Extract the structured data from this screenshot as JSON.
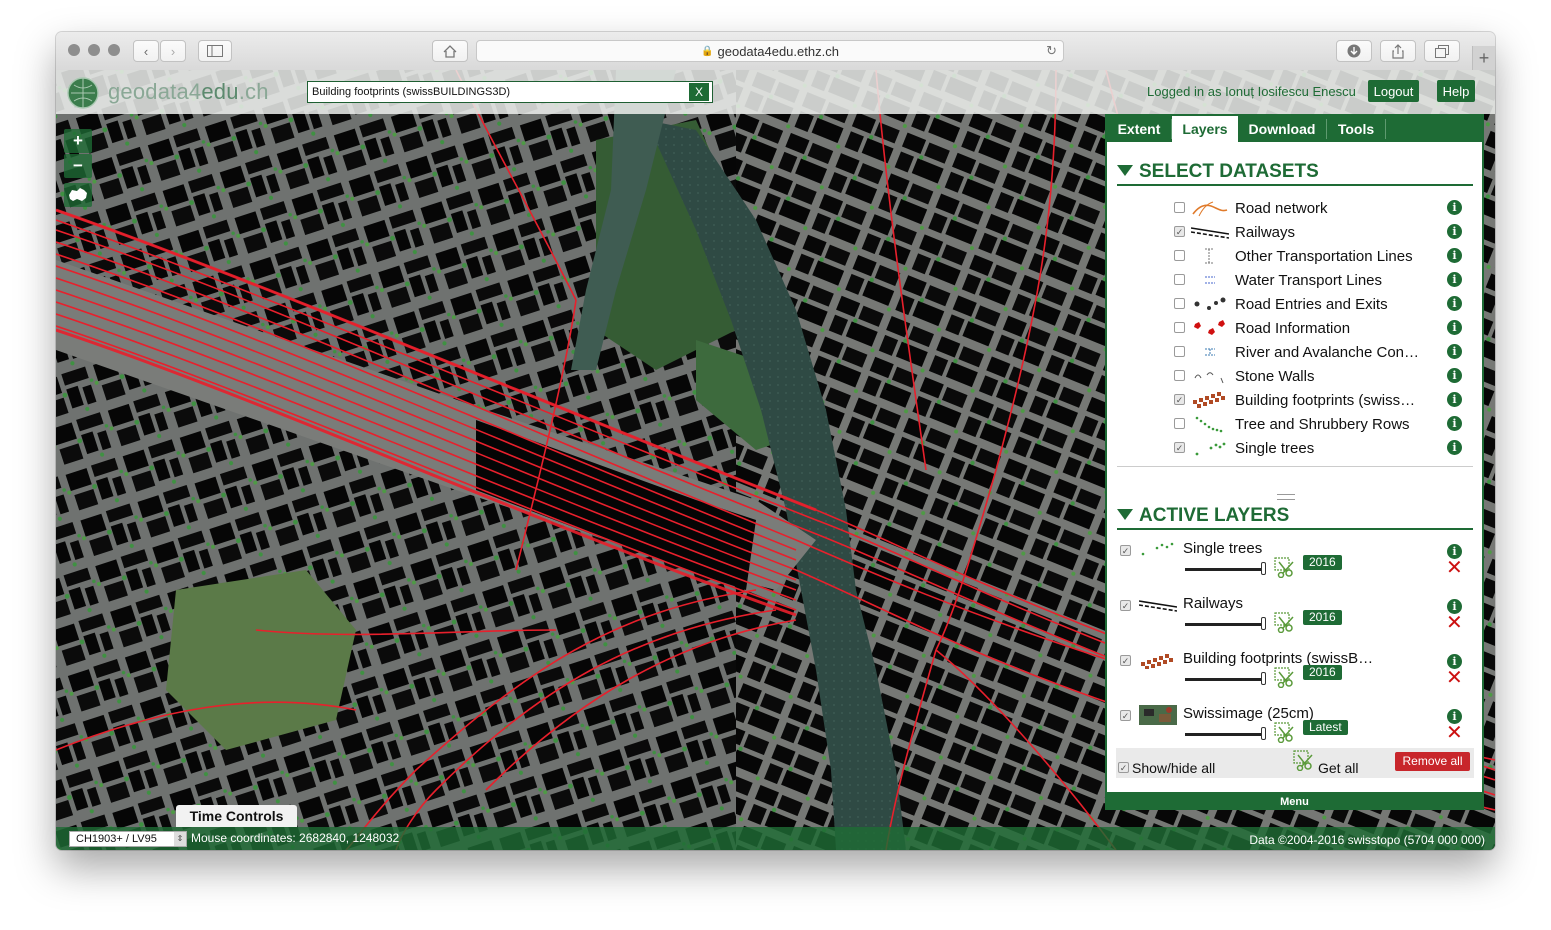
{
  "browser": {
    "url": "geodata4edu.ethz.ch"
  },
  "header": {
    "logo_main": "geodata4",
    "logo_suffix": "edu",
    "logo_tld": ".ch",
    "search_value": "Building footprints (swissBUILDINGS3D)",
    "search_clear": "X",
    "user_text": "Logged in as Ionuț Iosifescu Enescu",
    "logout_label": "Logout",
    "help_label": "Help"
  },
  "map_controls": {
    "zoom_in": "+",
    "zoom_out": "−"
  },
  "panel": {
    "tabs": [
      {
        "label": "Extent"
      },
      {
        "label": "Layers"
      },
      {
        "label": "Download"
      },
      {
        "label": "Tools"
      }
    ],
    "active_tab": "Layers",
    "select_title": "SELECT DATASETS",
    "datasets": [
      {
        "label": "Road network",
        "checked": false,
        "icon": "road-network-icon"
      },
      {
        "label": "Railways",
        "checked": true,
        "icon": "railways-icon"
      },
      {
        "label": "Other Transportation Lines",
        "checked": false,
        "icon": "transport-lines-icon"
      },
      {
        "label": "Water Transport Lines",
        "checked": false,
        "icon": "water-transport-icon"
      },
      {
        "label": "Road Entries and Exits",
        "checked": false,
        "icon": "road-entries-icon"
      },
      {
        "label": "Road Information",
        "checked": false,
        "icon": "road-information-icon"
      },
      {
        "label": "River and Avalanche Con…",
        "checked": false,
        "icon": "river-avalanche-icon"
      },
      {
        "label": "Stone Walls",
        "checked": false,
        "icon": "stone-walls-icon"
      },
      {
        "label": "Building footprints (swiss…",
        "checked": true,
        "icon": "building-footprints-icon"
      },
      {
        "label": "Tree and Shrubbery Rows",
        "checked": false,
        "icon": "tree-rows-icon"
      },
      {
        "label": "Single trees",
        "checked": true,
        "icon": "single-trees-icon"
      }
    ],
    "active_title": "ACTIVE LAYERS",
    "active_layers": [
      {
        "label": "Single trees",
        "year": "2016",
        "checked": true,
        "icon": "single-trees-icon"
      },
      {
        "label": "Railways",
        "year": "2016",
        "checked": true,
        "icon": "railways-icon"
      },
      {
        "label": "Building footprints (swissB…",
        "year": "2016",
        "checked": true,
        "icon": "building-footprints-icon"
      },
      {
        "label": "Swissimage (25cm)",
        "year": "Latest",
        "checked": true,
        "icon": "swissimage-thumbnail-icon"
      }
    ],
    "show_hide_all": "Show/hide all",
    "get_all": "Get all",
    "remove_all": "Remove all",
    "menu_label": "Menu"
  },
  "bottom": {
    "time_controls": "Time Controls",
    "crs_value": "CH1903+ / LV95",
    "mouse_coordinates": "Mouse coordinates: 2682840, 1248032",
    "copyright": "Data ©2004-2016 swisstopo (5704 000 000)"
  },
  "colors": {
    "brand_green": "#1e6b35",
    "rail_red": "#e8202c",
    "remove_red": "#c8262b"
  }
}
